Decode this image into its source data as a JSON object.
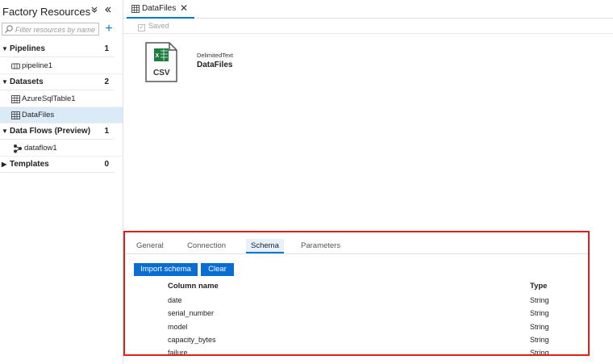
{
  "sidebar": {
    "title": "Factory Resources",
    "collapse_all_icon": "double-chevron-down-icon",
    "hide_icon": "double-chevron-left-icon",
    "search_placeholder": "Filter resources by name",
    "add_icon": "plus-icon",
    "sections": [
      {
        "label": "Pipelines",
        "count": "1",
        "items": [
          {
            "label": "pipeline1",
            "icon": "pipeline-icon"
          }
        ]
      },
      {
        "label": "Datasets",
        "count": "2",
        "items": [
          {
            "label": "AzureSqlTable1",
            "icon": "table-icon"
          },
          {
            "label": "DataFiles",
            "icon": "table-icon",
            "selected": true
          }
        ]
      },
      {
        "label": "Data Flows (Preview)",
        "count": "1",
        "items": [
          {
            "label": "dataflow1",
            "icon": "dataflow-icon"
          }
        ]
      },
      {
        "label": "Templates",
        "count": "0",
        "items": []
      }
    ]
  },
  "tab": {
    "label": "DataFiles",
    "icon": "table-icon",
    "close": "✕"
  },
  "toolbar": {
    "saved_label": "Saved"
  },
  "dataset": {
    "icon_text": "CSV",
    "type": "DelimitedText",
    "name": "DataFiles"
  },
  "panel": {
    "tabs": [
      "General",
      "Connection",
      "Schema",
      "Parameters"
    ],
    "active_tab": "Schema",
    "import_button": "Import schema",
    "clear_button": "Clear",
    "col_name_header": "Column name",
    "col_type_header": "Type",
    "rows": [
      {
        "name": "date",
        "type": "String"
      },
      {
        "name": "serial_number",
        "type": "String"
      },
      {
        "name": "model",
        "type": "String"
      },
      {
        "name": "capacity_bytes",
        "type": "String"
      },
      {
        "name": "failure",
        "type": "String"
      }
    ]
  },
  "colors": {
    "accent": "#0078d4",
    "highlight_border": "#e31c1c",
    "selected_bg": "#dbeaf7"
  }
}
